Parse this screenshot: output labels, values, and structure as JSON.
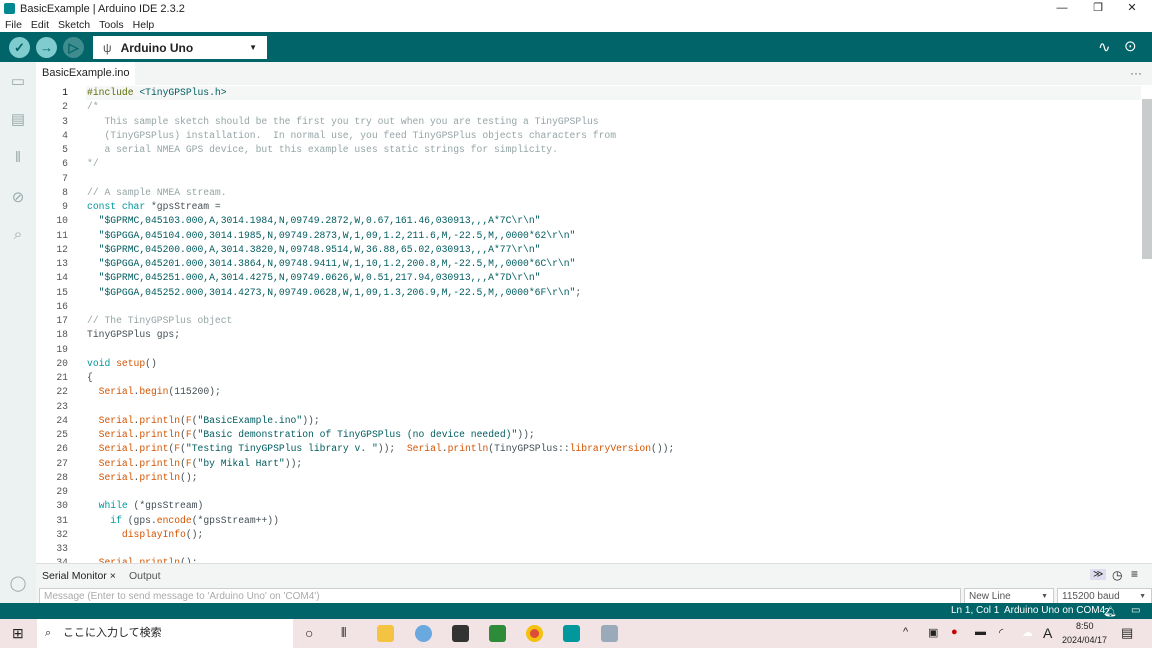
{
  "window": {
    "title": "BasicExample | Arduino IDE 2.3.2",
    "minimize": "—",
    "restore": "❐",
    "close": "✕"
  },
  "menu": [
    "File",
    "Edit",
    "Sketch",
    "Tools",
    "Help"
  ],
  "toolbar": {
    "verify_icon": "check-icon",
    "upload_icon": "arrow-right-icon",
    "debug_icon": "debug-icon",
    "board": "Arduino Uno",
    "serial_plotter_icon": "plotter-icon",
    "serial_monitor_icon": "monitor-icon"
  },
  "tab": {
    "name": "BasicExample.ino",
    "more": "···"
  },
  "editor": {
    "lines": [
      [
        [
          "#include",
          "pp"
        ],
        [
          " <TinyGPSPlus.h>",
          "str"
        ]
      ],
      [
        [
          "/*",
          "cm"
        ]
      ],
      [
        [
          "   This sample sketch should be the first you try out when you are testing a TinyGPSPlus",
          "cm"
        ]
      ],
      [
        [
          "   (TinyGPSPlus) installation.  In normal use, you feed TinyGPSPlus objects characters from",
          "cm"
        ]
      ],
      [
        [
          "   a serial NMEA GPS device, but this example uses static strings for simplicity.",
          "cm"
        ]
      ],
      [
        [
          "*/",
          "cm"
        ]
      ],
      [],
      [
        [
          "// A sample NMEA stream.",
          "cm"
        ]
      ],
      [
        [
          "const",
          "kw"
        ],
        [
          " ",
          ""
        ],
        [
          "char",
          "kw"
        ],
        [
          " *gpsStream =",
          ""
        ]
      ],
      [
        [
          "  \"$GPRMC,045103.000,A,3014.1984,N,09749.2872,W,0.67,161.46,030913,,,A*7C\\r\\n\"",
          "str"
        ]
      ],
      [
        [
          "  \"$GPGGA,045104.000,3014.1985,N,09749.2873,W,1,09,1.2,211.6,M,-22.5,M,,0000*62\\r\\n\"",
          "str"
        ]
      ],
      [
        [
          "  \"$GPRMC,045200.000,A,3014.3820,N,09748.9514,W,36.88,65.02,030913,,,A*77\\r\\n\"",
          "str"
        ]
      ],
      [
        [
          "  \"$GPGGA,045201.000,3014.3864,N,09748.9411,W,1,10,1.2,200.8,M,-22.5,M,,0000*6C\\r\\n\"",
          "str"
        ]
      ],
      [
        [
          "  \"$GPRMC,045251.000,A,3014.4275,N,09749.0626,W,0.51,217.94,030913,,,A*7D\\r\\n\"",
          "str"
        ]
      ],
      [
        [
          "  \"$GPGGA,045252.000,3014.4273,N,09749.0628,W,1,09,1.3,206.9,M,-22.5,M,,0000*6F\\r\\n\"",
          "str"
        ],
        [
          ";",
          ""
        ]
      ],
      [],
      [
        [
          "// The TinyGPSPlus object",
          "cm"
        ]
      ],
      [
        [
          "TinyGPSPlus gps;",
          ""
        ]
      ],
      [],
      [
        [
          "void",
          "kw"
        ],
        [
          " ",
          ""
        ],
        [
          "setup",
          "fn"
        ],
        [
          "()",
          ""
        ]
      ],
      [
        [
          "{",
          ""
        ]
      ],
      [
        [
          "  ",
          ""
        ],
        [
          "Serial",
          "fn"
        ],
        [
          ".",
          ""
        ],
        [
          "begin",
          "fn"
        ],
        [
          "(115200);",
          ""
        ]
      ],
      [],
      [
        [
          "  ",
          ""
        ],
        [
          "Serial",
          "fn"
        ],
        [
          ".",
          ""
        ],
        [
          "println",
          "fn"
        ],
        [
          "(",
          ""
        ],
        [
          "F",
          "fn"
        ],
        [
          "(",
          ""
        ],
        [
          "\"BasicExample.ino\"",
          "str"
        ],
        [
          "));",
          ""
        ]
      ],
      [
        [
          "  ",
          ""
        ],
        [
          "Serial",
          "fn"
        ],
        [
          ".",
          ""
        ],
        [
          "println",
          "fn"
        ],
        [
          "(",
          ""
        ],
        [
          "F",
          "fn"
        ],
        [
          "(",
          ""
        ],
        [
          "\"Basic demonstration of TinyGPSPlus (no device needed)\"",
          "str"
        ],
        [
          "));",
          ""
        ]
      ],
      [
        [
          "  ",
          ""
        ],
        [
          "Serial",
          "fn"
        ],
        [
          ".",
          ""
        ],
        [
          "print",
          "fn"
        ],
        [
          "(",
          ""
        ],
        [
          "F",
          "fn"
        ],
        [
          "(",
          ""
        ],
        [
          "\"Testing TinyGPSPlus library v. \"",
          "str"
        ],
        [
          "));  ",
          ""
        ],
        [
          "Serial",
          "fn"
        ],
        [
          ".",
          ""
        ],
        [
          "println",
          "fn"
        ],
        [
          "(TinyGPSPlus::",
          ""
        ],
        [
          "libraryVersion",
          "fn"
        ],
        [
          "());",
          ""
        ]
      ],
      [
        [
          "  ",
          ""
        ],
        [
          "Serial",
          "fn"
        ],
        [
          ".",
          ""
        ],
        [
          "println",
          "fn"
        ],
        [
          "(",
          ""
        ],
        [
          "F",
          "fn"
        ],
        [
          "(",
          ""
        ],
        [
          "\"by Mikal Hart\"",
          "str"
        ],
        [
          "));",
          ""
        ]
      ],
      [
        [
          "  ",
          ""
        ],
        [
          "Serial",
          "fn"
        ],
        [
          ".",
          ""
        ],
        [
          "println",
          "fn"
        ],
        [
          "();",
          ""
        ]
      ],
      [],
      [
        [
          "  ",
          ""
        ],
        [
          "while",
          "kw"
        ],
        [
          " (*gpsStream)",
          ""
        ]
      ],
      [
        [
          "    ",
          ""
        ],
        [
          "if",
          "kw"
        ],
        [
          " (gps.",
          ""
        ],
        [
          "encode",
          "fn"
        ],
        [
          "(*gpsStream++))",
          ""
        ]
      ],
      [
        [
          "      ",
          ""
        ],
        [
          "displayInfo",
          "fn"
        ],
        [
          "();",
          ""
        ]
      ],
      [],
      [
        [
          "  ",
          ""
        ],
        [
          "Serial",
          "fn"
        ],
        [
          ".",
          ""
        ],
        [
          "println",
          "fn"
        ],
        [
          "();",
          ""
        ]
      ]
    ]
  },
  "panel": {
    "serial_monitor_tab": "Serial Monitor",
    "close": "×",
    "output_tab": "Output",
    "message_placeholder": "Message (Enter to send message to 'Arduino Uno' on 'COM4')",
    "line_ending": "New Line",
    "baud": "115200 baud"
  },
  "status": {
    "position": "Ln 1, Col 1",
    "board": "Arduino Uno on COM4",
    "notifications": "2"
  },
  "taskbar": {
    "search_placeholder": "ここに入力して検索",
    "time": "8:50",
    "date": "2024/04/17",
    "ime": "A"
  },
  "colors": {
    "teal": "#006468",
    "keyword": "#00979d",
    "function": "#d35400",
    "string": "#005c5f",
    "comment": "#95a5a6"
  }
}
